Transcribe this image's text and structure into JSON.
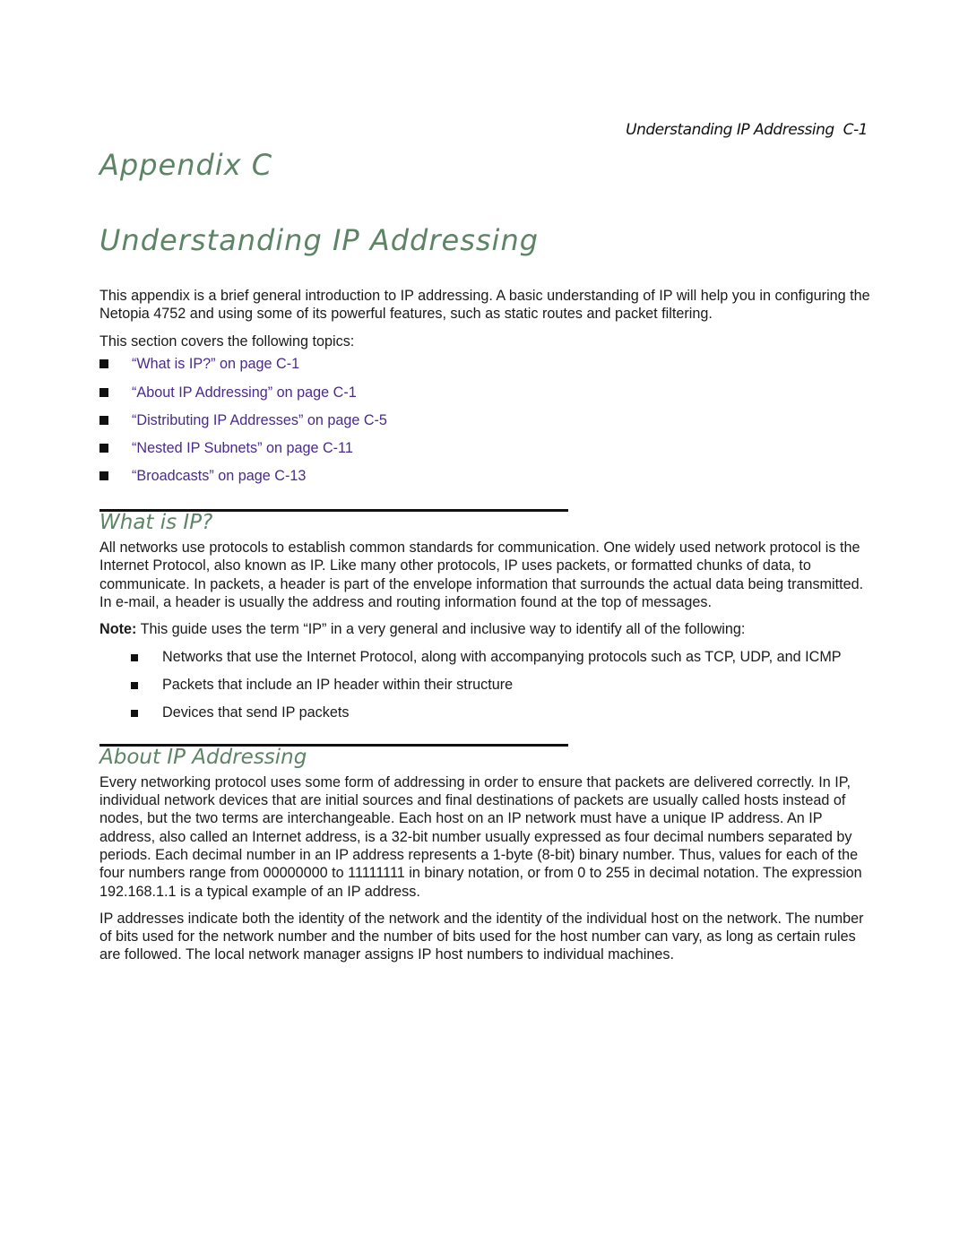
{
  "header": {
    "running_title": "Understanding IP Addressing",
    "page_number": "C-1"
  },
  "chapter": {
    "label": "Appendix C",
    "title": "Understanding IP Addressing"
  },
  "intro": {
    "paragraph": "This appendix is a brief general introduction to IP addressing. A basic understanding of IP will help you in configuring the Netopia 4752 and using some of its powerful features, such as static routes and packet filtering.",
    "topics_lead": "This section covers the following topics:",
    "topics": [
      {
        "label": "“What is IP?” on page C-1"
      },
      {
        "label": "“About IP Addressing” on page C-1"
      },
      {
        "label": "“Distributing IP Addresses” on page C-5"
      },
      {
        "label": "“Nested IP Subnets” on page C-11"
      },
      {
        "label": "“Broadcasts” on page C-13"
      }
    ]
  },
  "what_is_ip": {
    "heading": "What is IP?",
    "paragraph": "All networks use protocols to establish common standards for communication. One widely used network protocol is the Internet Protocol, also known as IP. Like many other protocols, IP uses packets, or formatted chunks of data, to communicate. In packets, a header is part of the envelope information that surrounds the actual data being transmitted. In e-mail, a header is usually the address and routing information found at the top of messages.",
    "note_label": "Note:",
    "note_text": "This guide uses the term “IP” in a very general and inclusive way to identify all of the following:",
    "items": [
      "Networks that use the Internet Protocol, along with accompanying protocols such as TCP, UDP, and ICMP",
      "Packets that include an IP header within their structure",
      "Devices that send IP packets"
    ]
  },
  "about_ip": {
    "heading": "About IP Addressing",
    "paragraphs": [
      "Every networking protocol uses some form of addressing in order to ensure that packets are delivered correctly. In IP, individual network devices that are initial sources and final destinations of packets are usually called hosts instead of nodes, but the two terms are interchangeable. Each host on an IP network must have a unique IP address. An IP address, also called an Internet address, is a 32-bit number usually expressed as four decimal numbers separated by periods. Each decimal number in an IP address represents a 1-byte (8-bit) binary number. Thus, values for each of the four numbers range from 00000000 to 11111111 in binary notation, or from 0 to 255 in decimal notation. The expression 192.168.1.1 is a typical example of an IP address.",
      "IP addresses indicate both the identity of the network and the identity of the individual host on the network. The number of bits used for the network number and the number of bits used for the host number can vary, as long as certain rules are followed. The local network manager assigns IP host numbers to individual machines."
    ]
  },
  "colors": {
    "heading_green": "#5e8466",
    "link_purple": "#4a2a8c"
  }
}
